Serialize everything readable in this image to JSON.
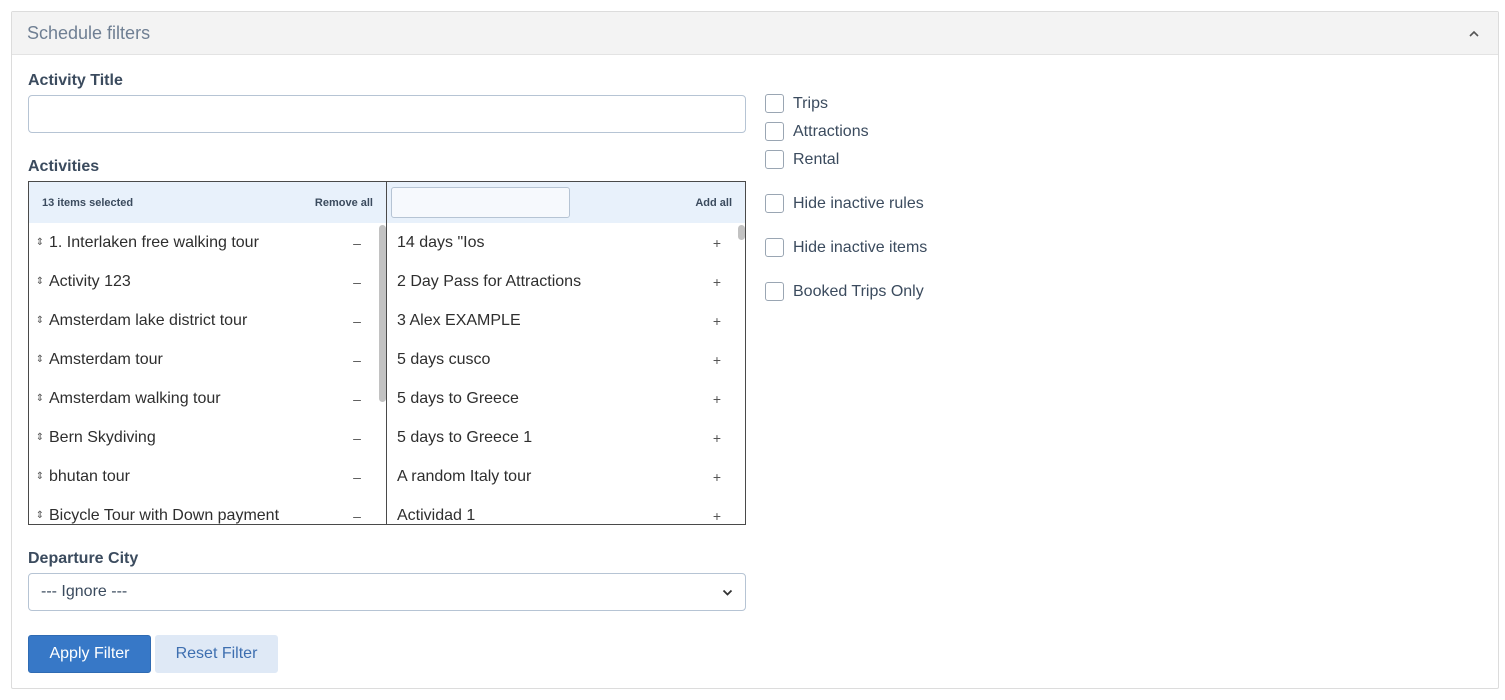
{
  "panel": {
    "title": "Schedule filters"
  },
  "activity_title": {
    "label": "Activity Title",
    "value": "",
    "placeholder": ""
  },
  "activities": {
    "label": "Activities",
    "selected_count": "13 items selected",
    "remove_all": "Remove all",
    "add_all": "Add all",
    "search_value": "",
    "selected_items": [
      {
        "label": "1. Interlaken free walking tour",
        "action": "–"
      },
      {
        "label": "Activity 123",
        "action": "–"
      },
      {
        "label": "Amsterdam lake district tour",
        "action": "–"
      },
      {
        "label": "Amsterdam tour",
        "action": "–"
      },
      {
        "label": "Amsterdam walking tour",
        "action": "–"
      },
      {
        "label": "Bern Skydiving",
        "action": "–"
      },
      {
        "label": "bhutan tour",
        "action": "–"
      },
      {
        "label": "Bicycle Tour with Down payment",
        "action": "–"
      }
    ],
    "available_items": [
      {
        "label": "14 days \"Ios",
        "action": "+"
      },
      {
        "label": "2 Day Pass for Attractions",
        "action": "+"
      },
      {
        "label": "3 Alex EXAMPLE",
        "action": "+"
      },
      {
        "label": "5 days cusco",
        "action": "+"
      },
      {
        "label": "5 days to Greece",
        "action": "+"
      },
      {
        "label": "5 days to Greece 1",
        "action": "+"
      },
      {
        "label": "A random Italy tour",
        "action": "+"
      },
      {
        "label": "Actividad 1",
        "action": "+"
      }
    ],
    "drag_glyph": "⇕"
  },
  "departure_city": {
    "label": "Departure City",
    "value": "--- Ignore ---"
  },
  "buttons": {
    "apply": "Apply Filter",
    "reset": "Reset Filter"
  },
  "checkboxes": [
    {
      "label": "Trips",
      "checked": false
    },
    {
      "label": "Attractions",
      "checked": false
    },
    {
      "label": "Rental",
      "checked": false
    },
    {
      "label": "Hide inactive rules",
      "checked": false
    },
    {
      "label": "Hide inactive items",
      "checked": false
    },
    {
      "label": "Booked Trips Only",
      "checked": false
    }
  ],
  "colors": {
    "primary": "#3778c7",
    "secondary_bg": "#dfe9f6",
    "list_header_bg": "#e8f1fb",
    "label": "#3b4b5e"
  }
}
